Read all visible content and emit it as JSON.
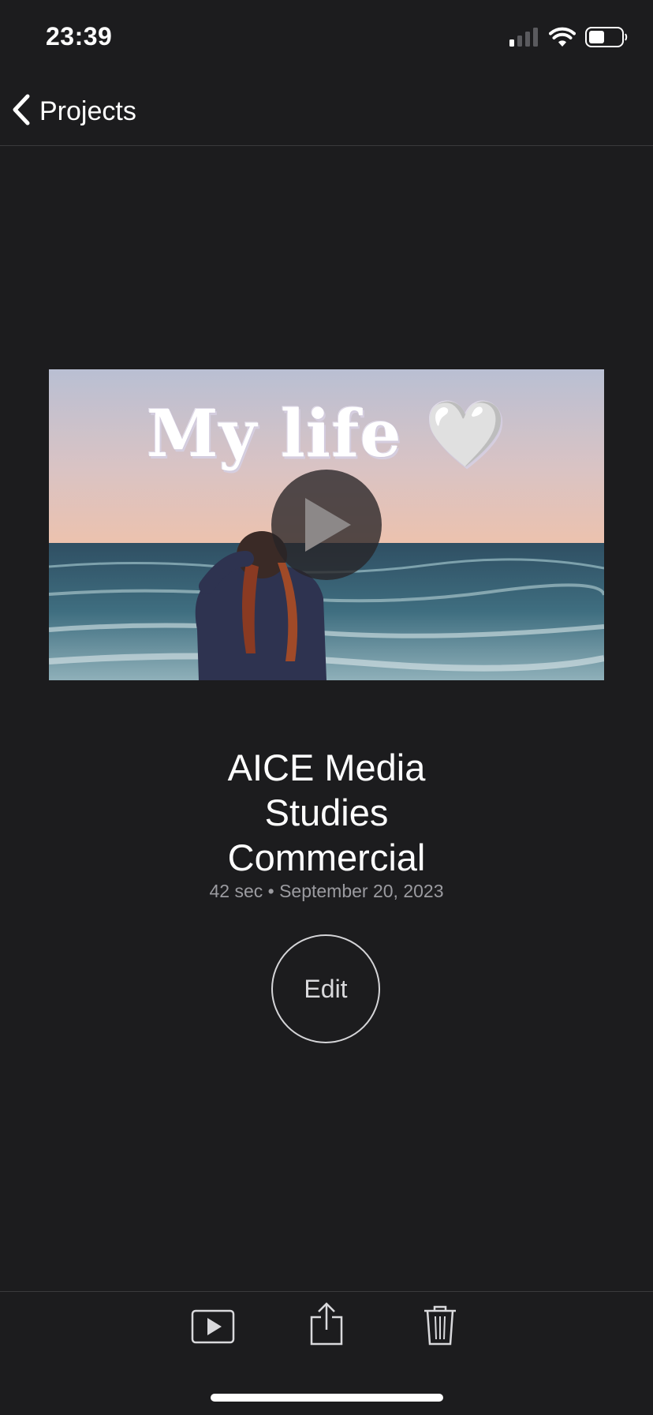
{
  "status_bar": {
    "time": "23:39",
    "icons": [
      "cellular-signal-icon",
      "wifi-icon",
      "battery-icon"
    ]
  },
  "nav": {
    "back_label": "Projects",
    "back_icon": "chevron-left-icon"
  },
  "thumbnail": {
    "overlay_text": "My life 🤍",
    "play_icon": "play-icon"
  },
  "project": {
    "title_lines": [
      "AICE Media",
      "Studies",
      "Commercial"
    ],
    "meta": "42 sec • September 20, 2023"
  },
  "edit_button": {
    "label": "Edit"
  },
  "toolbar": {
    "icons": [
      "play-preview-icon",
      "share-icon",
      "trash-icon"
    ]
  },
  "colors": {
    "background": "#1c1c1e",
    "text_primary": "#ffffff",
    "text_secondary": "#9b9ba0",
    "separator": "#3a3a3c"
  }
}
